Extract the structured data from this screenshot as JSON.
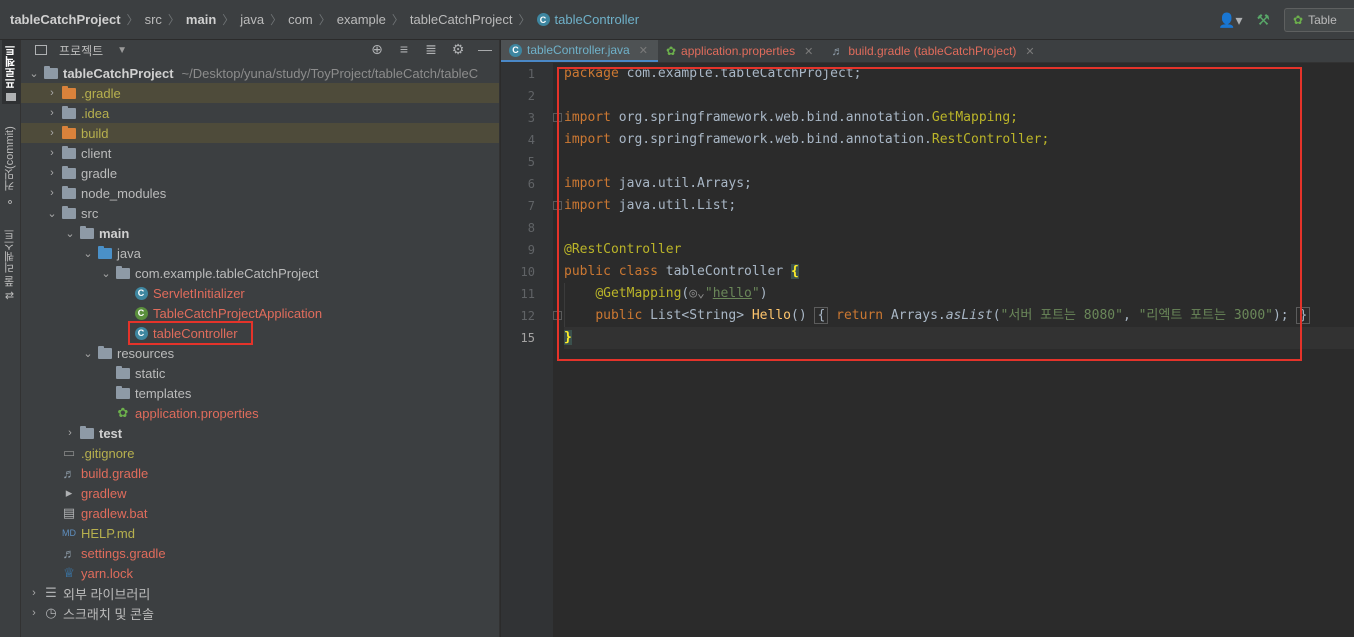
{
  "breadcrumb": {
    "project": "tableCatchProject",
    "items": [
      "src",
      "main",
      "java",
      "com",
      "example",
      "tableCatchProject"
    ],
    "current": "tableController"
  },
  "run_config": {
    "label": "Table"
  },
  "toolstrip": {
    "project_tab": "프로젝트",
    "commit_tab": "커밋(commit)",
    "pull_requests_tab": "풀 리퀘스트"
  },
  "project_panel": {
    "title": "프로젝트",
    "root": {
      "name": "tableCatchProject",
      "path": "~/Desktop/yuna/study/ToyProject/tableCatch/tableC"
    },
    "items": [
      ".gradle",
      ".idea",
      "build",
      "client",
      "gradle",
      "node_modules",
      "src",
      "main",
      "java",
      "com.example.tableCatchProject",
      "ServletInitializer",
      "TableCatchProjectApplication",
      "tableController",
      "resources",
      "static",
      "templates",
      "application.properties",
      "test",
      ".gitignore",
      "build.gradle",
      "gradlew",
      "gradlew.bat",
      "HELP.md",
      "settings.gradle",
      "yarn.lock",
      "외부 라이브러리",
      "스크래치 및 콘솔"
    ]
  },
  "editor": {
    "tabs": [
      {
        "label": "tableController.java",
        "active": true
      },
      {
        "label": "application.properties",
        "active": false
      },
      {
        "label": "build.gradle (tableCatchProject)",
        "active": false
      }
    ],
    "line_numbers": [
      "1",
      "2",
      "3",
      "4",
      "5",
      "6",
      "7",
      "8",
      "9",
      "10",
      "11",
      "12",
      "15"
    ],
    "code": {
      "package_kw": "package",
      "package_name": " com.example.tableCatchProject;",
      "import_kw": "import",
      "import1_pkg": " org.springframework.web.bind.annotation.",
      "import1_cls": "GetMapping;",
      "import2_pkg": " org.springframework.web.bind.annotation.",
      "import2_cls": "RestController;",
      "import3": " java.util.Arrays;",
      "import4": " java.util.List;",
      "annotation_rest": "@RestController",
      "class_kw": "public class",
      "class_name": " tableController ",
      "open_brace": "{",
      "getmapping": "@GetMapping",
      "mapping_path": "hello",
      "method_kw": "public",
      "method_type": " List<String> ",
      "method_name": "Hello",
      "return_kw": "return",
      "arrays": " Arrays.",
      "aslist": "asList",
      "str1": "\"서버 포트는 8080\"",
      "str2": "\"리엑트 포트는 3000\"",
      "close_brace": "}"
    }
  },
  "colors": {
    "highlight_box": "#e5332a",
    "keyword": "#cc7832",
    "annotation": "#bbb529",
    "string": "#6a8759",
    "method": "#ffc66d",
    "active_tab": "#6fb1c9"
  }
}
